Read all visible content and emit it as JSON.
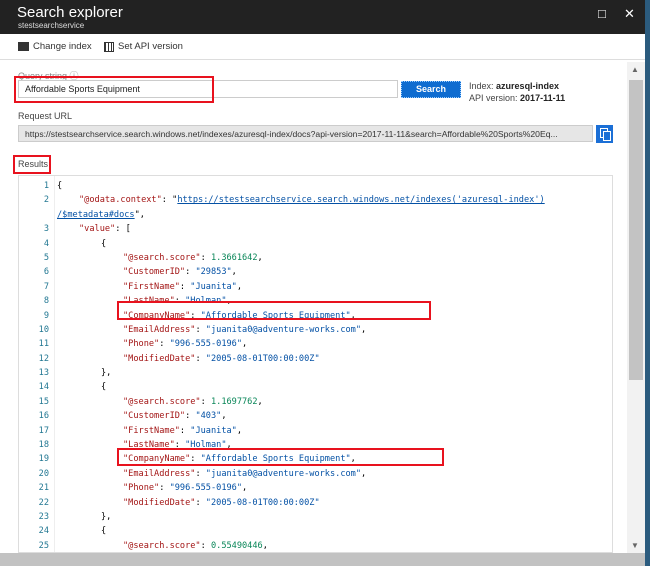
{
  "window": {
    "title": "Search explorer",
    "subtitle": "stestsearchservice",
    "maximize_icon": "□",
    "close_icon": "✕"
  },
  "toolbar": {
    "change_index": "Change index",
    "set_api_version": "Set API version"
  },
  "query": {
    "label": "Query string",
    "info_icon": "ⓘ",
    "value": "Affordable Sports Equipment",
    "search_button": "Search"
  },
  "index_info": {
    "index_label": "Index:",
    "index_value": "azuresql-index",
    "api_label": "API version:",
    "api_value": "2017-11-11"
  },
  "request": {
    "label": "Request URL",
    "url": "https://stestsearchservice.search.windows.net/indexes/azuresql-index/docs?api-version=2017-11-11&search=Affordable%20Sports%20Eq..."
  },
  "results": {
    "label": "Results",
    "lines": [
      {
        "n": "1",
        "indent": 0,
        "parts": [
          [
            "p",
            "{"
          ]
        ]
      },
      {
        "n": "2",
        "indent": 1,
        "parts": [
          [
            "k",
            "\"@odata.context\""
          ],
          [
            "p",
            ": \""
          ],
          [
            "u",
            "https://stestsearchservice.search.windows.net/indexes('azuresql-index')"
          ]
        ]
      },
      {
        "n": "",
        "indent": 0,
        "parts": [
          [
            "u",
            "/$metadata#docs"
          ],
          [
            "p",
            "\","
          ]
        ]
      },
      {
        "n": "3",
        "indent": 1,
        "parts": [
          [
            "k",
            "\"value\""
          ],
          [
            "p",
            ": ["
          ]
        ]
      },
      {
        "n": "4",
        "indent": 2,
        "parts": [
          [
            "p",
            "{"
          ]
        ]
      },
      {
        "n": "5",
        "indent": 3,
        "parts": [
          [
            "k",
            "\"@search.score\""
          ],
          [
            "p",
            ": "
          ],
          [
            "num",
            "1.3661642"
          ],
          [
            "p",
            ","
          ]
        ]
      },
      {
        "n": "6",
        "indent": 3,
        "parts": [
          [
            "k",
            "\"CustomerID\""
          ],
          [
            "p",
            ": "
          ],
          [
            "s",
            "\"29853\""
          ],
          [
            "p",
            ","
          ]
        ]
      },
      {
        "n": "7",
        "indent": 3,
        "parts": [
          [
            "k",
            "\"FirstName\""
          ],
          [
            "p",
            ": "
          ],
          [
            "s",
            "\"Juanita\""
          ],
          [
            "p",
            ","
          ]
        ]
      },
      {
        "n": "8",
        "indent": 3,
        "parts": [
          [
            "k",
            "\"LastName\""
          ],
          [
            "p",
            ": "
          ],
          [
            "s",
            "\"Holman\""
          ],
          [
            "p",
            ","
          ]
        ]
      },
      {
        "n": "9",
        "indent": 3,
        "parts": [
          [
            "k",
            "\"CompanyName\""
          ],
          [
            "p",
            ": "
          ],
          [
            "s",
            "\"Affordable Sports Equipment\""
          ],
          [
            "p",
            ","
          ]
        ]
      },
      {
        "n": "10",
        "indent": 3,
        "parts": [
          [
            "k",
            "\"EmailAddress\""
          ],
          [
            "p",
            ": "
          ],
          [
            "s",
            "\"juanita0@adventure-works.com\""
          ],
          [
            "p",
            ","
          ]
        ]
      },
      {
        "n": "11",
        "indent": 3,
        "parts": [
          [
            "k",
            "\"Phone\""
          ],
          [
            "p",
            ": "
          ],
          [
            "s",
            "\"996-555-0196\""
          ],
          [
            "p",
            ","
          ]
        ]
      },
      {
        "n": "12",
        "indent": 3,
        "parts": [
          [
            "k",
            "\"ModifiedDate\""
          ],
          [
            "p",
            ": "
          ],
          [
            "s",
            "\"2005-08-01T00:00:00Z\""
          ]
        ]
      },
      {
        "n": "13",
        "indent": 2,
        "parts": [
          [
            "p",
            "},"
          ]
        ]
      },
      {
        "n": "14",
        "indent": 2,
        "parts": [
          [
            "p",
            "{"
          ]
        ]
      },
      {
        "n": "15",
        "indent": 3,
        "parts": [
          [
            "k",
            "\"@search.score\""
          ],
          [
            "p",
            ": "
          ],
          [
            "num",
            "1.1697762"
          ],
          [
            "p",
            ","
          ]
        ]
      },
      {
        "n": "16",
        "indent": 3,
        "parts": [
          [
            "k",
            "\"CustomerID\""
          ],
          [
            "p",
            ": "
          ],
          [
            "s",
            "\"403\""
          ],
          [
            "p",
            ","
          ]
        ]
      },
      {
        "n": "17",
        "indent": 3,
        "parts": [
          [
            "k",
            "\"FirstName\""
          ],
          [
            "p",
            ": "
          ],
          [
            "s",
            "\"Juanita\""
          ],
          [
            "p",
            ","
          ]
        ]
      },
      {
        "n": "18",
        "indent": 3,
        "parts": [
          [
            "k",
            "\"LastName\""
          ],
          [
            "p",
            ": "
          ],
          [
            "s",
            "\"Holman\""
          ],
          [
            "p",
            ","
          ]
        ]
      },
      {
        "n": "19",
        "indent": 3,
        "parts": [
          [
            "k",
            "\"CompanyName\""
          ],
          [
            "p",
            ": "
          ],
          [
            "s",
            "\"Affordable Sports Equipment\""
          ],
          [
            "p",
            ","
          ]
        ]
      },
      {
        "n": "20",
        "indent": 3,
        "parts": [
          [
            "k",
            "\"EmailAddress\""
          ],
          [
            "p",
            ": "
          ],
          [
            "s",
            "\"juanita0@adventure-works.com\""
          ],
          [
            "p",
            ","
          ]
        ]
      },
      {
        "n": "21",
        "indent": 3,
        "parts": [
          [
            "k",
            "\"Phone\""
          ],
          [
            "p",
            ": "
          ],
          [
            "s",
            "\"996-555-0196\""
          ],
          [
            "p",
            ","
          ]
        ]
      },
      {
        "n": "22",
        "indent": 3,
        "parts": [
          [
            "k",
            "\"ModifiedDate\""
          ],
          [
            "p",
            ": "
          ],
          [
            "s",
            "\"2005-08-01T00:00:00Z\""
          ]
        ]
      },
      {
        "n": "23",
        "indent": 2,
        "parts": [
          [
            "p",
            "},"
          ]
        ]
      },
      {
        "n": "24",
        "indent": 2,
        "parts": [
          [
            "p",
            "{"
          ]
        ]
      },
      {
        "n": "25",
        "indent": 3,
        "parts": [
          [
            "k",
            "\"@search.score\""
          ],
          [
            "p",
            ": "
          ],
          [
            "num",
            "0.55490446"
          ],
          [
            "p",
            ","
          ]
        ]
      }
    ]
  },
  "colors": {
    "highlight": "#e8121e",
    "accent": "#0f6cd0"
  }
}
